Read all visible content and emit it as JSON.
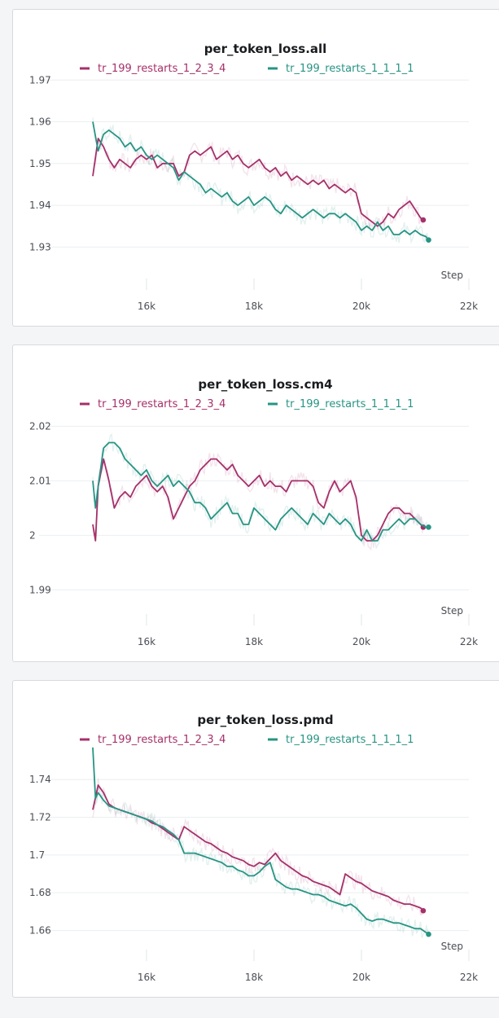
{
  "colors": {
    "series_a": "#a5306a",
    "series_b": "#279484",
    "grid": "#eceef1",
    "panel_bg": "#ffffff"
  },
  "legend": {
    "series_a": "tr_199_restarts_1_2_3_4",
    "series_b": "tr_199_restarts_1_1_1_1"
  },
  "chart_data": [
    {
      "type": "line",
      "title": "per_token_loss.all",
      "xlabel": "Step",
      "xlim": [
        14000,
        22000
      ],
      "ylim": [
        1.925,
        1.972
      ],
      "xticks": [
        16000,
        18000,
        20000,
        22000
      ],
      "xtick_labels": [
        "16k",
        "18k",
        "20k",
        "22k"
      ],
      "yticks": [
        1.93,
        1.94,
        1.95,
        1.96,
        1.97
      ],
      "ytick_labels": [
        "1.93",
        "1.94",
        "1.95",
        "1.96",
        "1.97"
      ],
      "series": [
        {
          "name": "tr_199_restarts_1_2_3_4",
          "x": [
            15000,
            15100,
            15200,
            15300,
            15400,
            15500,
            15600,
            15700,
            15800,
            15900,
            16000,
            16100,
            16200,
            16300,
            16400,
            16500,
            16600,
            16700,
            16800,
            16900,
            17000,
            17100,
            17200,
            17300,
            17400,
            17500,
            17600,
            17700,
            17800,
            17900,
            18000,
            18100,
            18200,
            18300,
            18400,
            18500,
            18600,
            18700,
            18800,
            18900,
            19000,
            19100,
            19200,
            19300,
            19400,
            19500,
            19600,
            19700,
            19800,
            19900,
            20000,
            20100,
            20200,
            20300,
            20400,
            20500,
            20600,
            20700,
            20800,
            20900,
            21000,
            21100,
            21150
          ],
          "y": [
            1.947,
            1.956,
            1.954,
            1.951,
            1.949,
            1.951,
            1.95,
            1.949,
            1.951,
            1.952,
            1.951,
            1.952,
            1.949,
            1.95,
            1.95,
            1.95,
            1.947,
            1.948,
            1.952,
            1.953,
            1.952,
            1.953,
            1.954,
            1.951,
            1.952,
            1.953,
            1.951,
            1.952,
            1.95,
            1.949,
            1.95,
            1.951,
            1.949,
            1.948,
            1.949,
            1.947,
            1.948,
            1.946,
            1.947,
            1.946,
            1.945,
            1.946,
            1.945,
            1.946,
            1.944,
            1.945,
            1.944,
            1.943,
            1.944,
            1.943,
            1.938,
            1.937,
            1.936,
            1.935,
            1.936,
            1.938,
            1.937,
            1.939,
            1.94,
            1.941,
            1.939,
            1.937,
            1.9365
          ]
        },
        {
          "name": "tr_199_restarts_1_1_1_1",
          "x": [
            15000,
            15100,
            15200,
            15300,
            15400,
            15500,
            15600,
            15700,
            15800,
            15900,
            16000,
            16100,
            16200,
            16300,
            16400,
            16500,
            16600,
            16700,
            16800,
            16900,
            17000,
            17100,
            17200,
            17300,
            17400,
            17500,
            17600,
            17700,
            17800,
            17900,
            18000,
            18100,
            18200,
            18300,
            18400,
            18500,
            18600,
            18700,
            18800,
            18900,
            19000,
            19100,
            19200,
            19300,
            19400,
            19500,
            19600,
            19700,
            19800,
            19900,
            20000,
            20100,
            20200,
            20300,
            20400,
            20500,
            20600,
            20700,
            20800,
            20900,
            21000,
            21100,
            21200,
            21250
          ],
          "y": [
            1.96,
            1.953,
            1.957,
            1.958,
            1.957,
            1.956,
            1.954,
            1.955,
            1.953,
            1.954,
            1.952,
            1.951,
            1.952,
            1.951,
            1.95,
            1.949,
            1.946,
            1.948,
            1.947,
            1.946,
            1.945,
            1.943,
            1.944,
            1.943,
            1.942,
            1.943,
            1.941,
            1.94,
            1.941,
            1.942,
            1.94,
            1.941,
            1.942,
            1.941,
            1.939,
            1.938,
            1.94,
            1.939,
            1.938,
            1.937,
            1.938,
            1.939,
            1.938,
            1.937,
            1.938,
            1.938,
            1.937,
            1.938,
            1.937,
            1.936,
            1.934,
            1.935,
            1.934,
            1.936,
            1.934,
            1.935,
            1.933,
            1.933,
            1.934,
            1.933,
            1.934,
            1.933,
            1.9325,
            1.9317
          ]
        }
      ]
    },
    {
      "type": "line",
      "title": "per_token_loss.cm4",
      "xlabel": "Step",
      "xlim": [
        14000,
        22000
      ],
      "ylim": [
        1.9875,
        2.0235
      ],
      "xticks": [
        16000,
        18000,
        20000,
        22000
      ],
      "xtick_labels": [
        "16k",
        "18k",
        "20k",
        "22k"
      ],
      "yticks": [
        1.99,
        2.0,
        2.01,
        2.02
      ],
      "ytick_labels": [
        "1.99",
        "2",
        "2.01",
        "2.02"
      ],
      "series": [
        {
          "name": "tr_199_restarts_1_2_3_4",
          "x": [
            15000,
            15050,
            15100,
            15200,
            15300,
            15400,
            15500,
            15600,
            15700,
            15800,
            15900,
            16000,
            16100,
            16200,
            16300,
            16400,
            16500,
            16600,
            16700,
            16800,
            16900,
            17000,
            17100,
            17200,
            17300,
            17400,
            17500,
            17600,
            17700,
            17800,
            17900,
            18000,
            18100,
            18200,
            18300,
            18400,
            18500,
            18600,
            18700,
            18800,
            18900,
            19000,
            19100,
            19200,
            19300,
            19400,
            19500,
            19600,
            19700,
            19800,
            19900,
            20000,
            20100,
            20200,
            20300,
            20400,
            20500,
            20600,
            20700,
            20800,
            20900,
            21000,
            21100,
            21150
          ],
          "y": [
            2.002,
            1.999,
            2.009,
            2.014,
            2.01,
            2.005,
            2.007,
            2.008,
            2.007,
            2.009,
            2.01,
            2.011,
            2.009,
            2.008,
            2.009,
            2.007,
            2.003,
            2.005,
            2.007,
            2.009,
            2.01,
            2.012,
            2.013,
            2.014,
            2.014,
            2.013,
            2.012,
            2.013,
            2.011,
            2.01,
            2.009,
            2.01,
            2.011,
            2.009,
            2.01,
            2.009,
            2.009,
            2.008,
            2.01,
            2.01,
            2.01,
            2.01,
            2.009,
            2.006,
            2.005,
            2.008,
            2.01,
            2.008,
            2.009,
            2.01,
            2.007,
            2.0,
            1.999,
            1.999,
            2.0,
            2.002,
            2.004,
            2.005,
            2.005,
            2.004,
            2.004,
            2.003,
            2.002,
            2.0015
          ]
        },
        {
          "name": "tr_199_restarts_1_1_1_1",
          "x": [
            15000,
            15050,
            15100,
            15200,
            15300,
            15400,
            15500,
            15600,
            15700,
            15800,
            15900,
            16000,
            16100,
            16200,
            16300,
            16400,
            16500,
            16600,
            16700,
            16800,
            16900,
            17000,
            17100,
            17200,
            17300,
            17400,
            17500,
            17600,
            17700,
            17800,
            17900,
            18000,
            18100,
            18200,
            18300,
            18400,
            18500,
            18600,
            18700,
            18800,
            18900,
            19000,
            19100,
            19200,
            19300,
            19400,
            19500,
            19600,
            19700,
            19800,
            19900,
            20000,
            20100,
            20200,
            20300,
            20400,
            20500,
            20600,
            20700,
            20800,
            20900,
            21000,
            21100,
            21200,
            21250
          ],
          "y": [
            2.01,
            2.005,
            2.009,
            2.016,
            2.017,
            2.017,
            2.016,
            2.014,
            2.013,
            2.012,
            2.011,
            2.012,
            2.01,
            2.009,
            2.01,
            2.011,
            2.009,
            2.01,
            2.009,
            2.008,
            2.006,
            2.006,
            2.005,
            2.003,
            2.004,
            2.005,
            2.006,
            2.004,
            2.004,
            2.002,
            2.002,
            2.005,
            2.004,
            2.003,
            2.002,
            2.001,
            2.003,
            2.004,
            2.005,
            2.004,
            2.003,
            2.002,
            2.004,
            2.003,
            2.002,
            2.004,
            2.003,
            2.002,
            2.003,
            2.002,
            2.0,
            1.999,
            2.001,
            1.999,
            1.999,
            2.001,
            2.001,
            2.002,
            2.003,
            2.002,
            2.003,
            2.003,
            2.002,
            2.0015,
            2.0015
          ]
        }
      ]
    },
    {
      "type": "line",
      "title": "per_token_loss.pmd",
      "xlabel": "Step",
      "xlim": [
        14000,
        22000
      ],
      "ylim": [
        1.6555,
        1.7595
      ],
      "xticks": [
        16000,
        18000,
        20000,
        22000
      ],
      "xtick_labels": [
        "16k",
        "18k",
        "20k",
        "22k"
      ],
      "yticks": [
        1.66,
        1.68,
        1.7,
        1.72,
        1.74
      ],
      "ytick_labels": [
        "1.66",
        "1.68",
        "1.7",
        "1.72",
        "1.74"
      ],
      "series": [
        {
          "name": "tr_199_restarts_1_2_3_4",
          "x": [
            15000,
            15100,
            15200,
            15300,
            15400,
            15500,
            15600,
            15700,
            15800,
            15900,
            16000,
            16100,
            16200,
            16300,
            16400,
            16500,
            16600,
            16700,
            16800,
            16900,
            17000,
            17100,
            17200,
            17300,
            17400,
            17500,
            17600,
            17700,
            17800,
            17900,
            18000,
            18100,
            18200,
            18300,
            18400,
            18500,
            18600,
            18700,
            18800,
            18900,
            19000,
            19100,
            19200,
            19300,
            19400,
            19500,
            19600,
            19700,
            19800,
            19900,
            20000,
            20100,
            20200,
            20300,
            20400,
            20500,
            20600,
            20700,
            20800,
            20900,
            21000,
            21100,
            21150
          ],
          "y": [
            1.724,
            1.737,
            1.733,
            1.727,
            1.725,
            1.724,
            1.723,
            1.722,
            1.721,
            1.72,
            1.719,
            1.717,
            1.716,
            1.714,
            1.712,
            1.71,
            1.708,
            1.715,
            1.713,
            1.711,
            1.709,
            1.707,
            1.706,
            1.704,
            1.702,
            1.701,
            1.699,
            1.698,
            1.697,
            1.695,
            1.694,
            1.696,
            1.695,
            1.698,
            1.701,
            1.697,
            1.695,
            1.693,
            1.691,
            1.689,
            1.688,
            1.686,
            1.685,
            1.684,
            1.683,
            1.681,
            1.679,
            1.69,
            1.688,
            1.686,
            1.685,
            1.683,
            1.681,
            1.68,
            1.679,
            1.678,
            1.676,
            1.675,
            1.674,
            1.674,
            1.673,
            1.672,
            1.6705
          ]
        },
        {
          "name": "tr_199_restarts_1_1_1_1",
          "x": [
            15000,
            15050,
            15100,
            15200,
            15300,
            15400,
            15500,
            15600,
            15700,
            15800,
            15900,
            16000,
            16100,
            16200,
            16300,
            16400,
            16500,
            16600,
            16700,
            16800,
            16900,
            17000,
            17100,
            17200,
            17300,
            17400,
            17500,
            17600,
            17700,
            17800,
            17900,
            18000,
            18100,
            18200,
            18300,
            18400,
            18500,
            18600,
            18700,
            18800,
            18900,
            19000,
            19100,
            19200,
            19300,
            19400,
            19500,
            19600,
            19700,
            19800,
            19900,
            20000,
            20100,
            20200,
            20300,
            20400,
            20500,
            20600,
            20700,
            20800,
            20900,
            21000,
            21100,
            21200,
            21250
          ],
          "y": [
            1.757,
            1.73,
            1.733,
            1.729,
            1.726,
            1.725,
            1.724,
            1.723,
            1.722,
            1.721,
            1.72,
            1.719,
            1.718,
            1.716,
            1.715,
            1.713,
            1.711,
            1.708,
            1.701,
            1.701,
            1.701,
            1.7,
            1.699,
            1.698,
            1.697,
            1.696,
            1.694,
            1.694,
            1.692,
            1.691,
            1.689,
            1.689,
            1.691,
            1.694,
            1.696,
            1.687,
            1.685,
            1.683,
            1.682,
            1.682,
            1.681,
            1.68,
            1.679,
            1.679,
            1.678,
            1.676,
            1.675,
            1.674,
            1.673,
            1.674,
            1.672,
            1.669,
            1.666,
            1.665,
            1.666,
            1.666,
            1.665,
            1.664,
            1.664,
            1.663,
            1.662,
            1.661,
            1.661,
            1.659,
            1.658
          ]
        }
      ]
    }
  ]
}
